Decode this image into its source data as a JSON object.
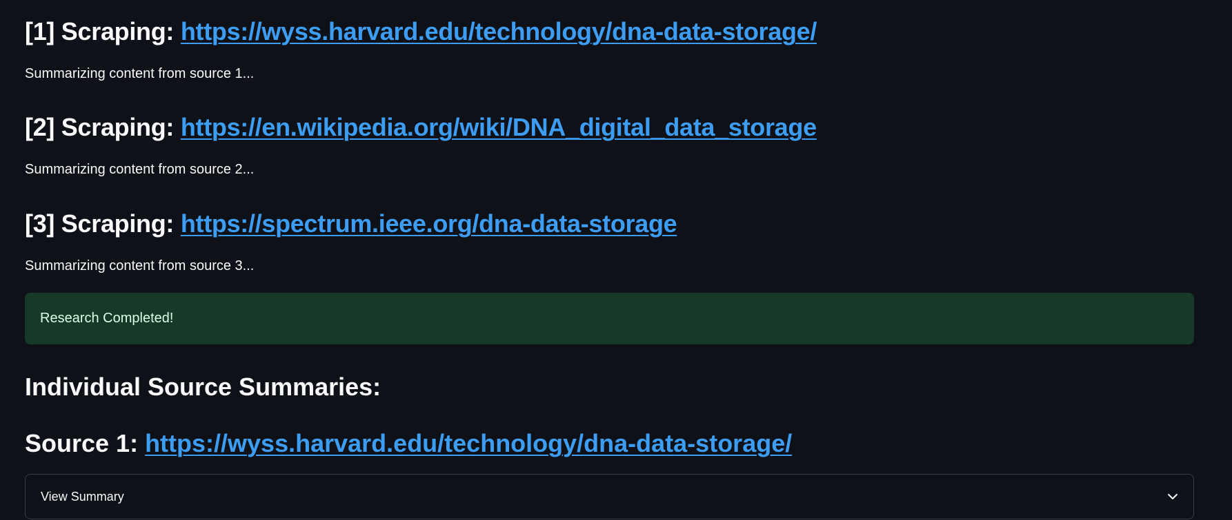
{
  "scrapes": [
    {
      "prefix": "[1] Scraping: ",
      "url": "https://wyss.harvard.edu/technology/dna-data-storage/",
      "status": "Summarizing content from source 1..."
    },
    {
      "prefix": "[2] Scraping: ",
      "url": "https://en.wikipedia.org/wiki/DNA_digital_data_storage",
      "status": "Summarizing content from source 2..."
    },
    {
      "prefix": "[3] Scraping: ",
      "url": "https://spectrum.ieee.org/dna-data-storage",
      "status": "Summarizing content from source 3..."
    }
  ],
  "success_message": "Research Completed!",
  "summaries_title": "Individual Source Summaries:",
  "source_1": {
    "prefix": "Source 1: ",
    "url": "https://wyss.harvard.edu/technology/dna-data-storage/",
    "expander_label": "View Summary",
    "expander_icon": "chevron-down-icon"
  },
  "colors": {
    "background": "#0e1117",
    "link": "#3d9df3",
    "success_bg": "#173928",
    "success_text": "#dffde9"
  }
}
